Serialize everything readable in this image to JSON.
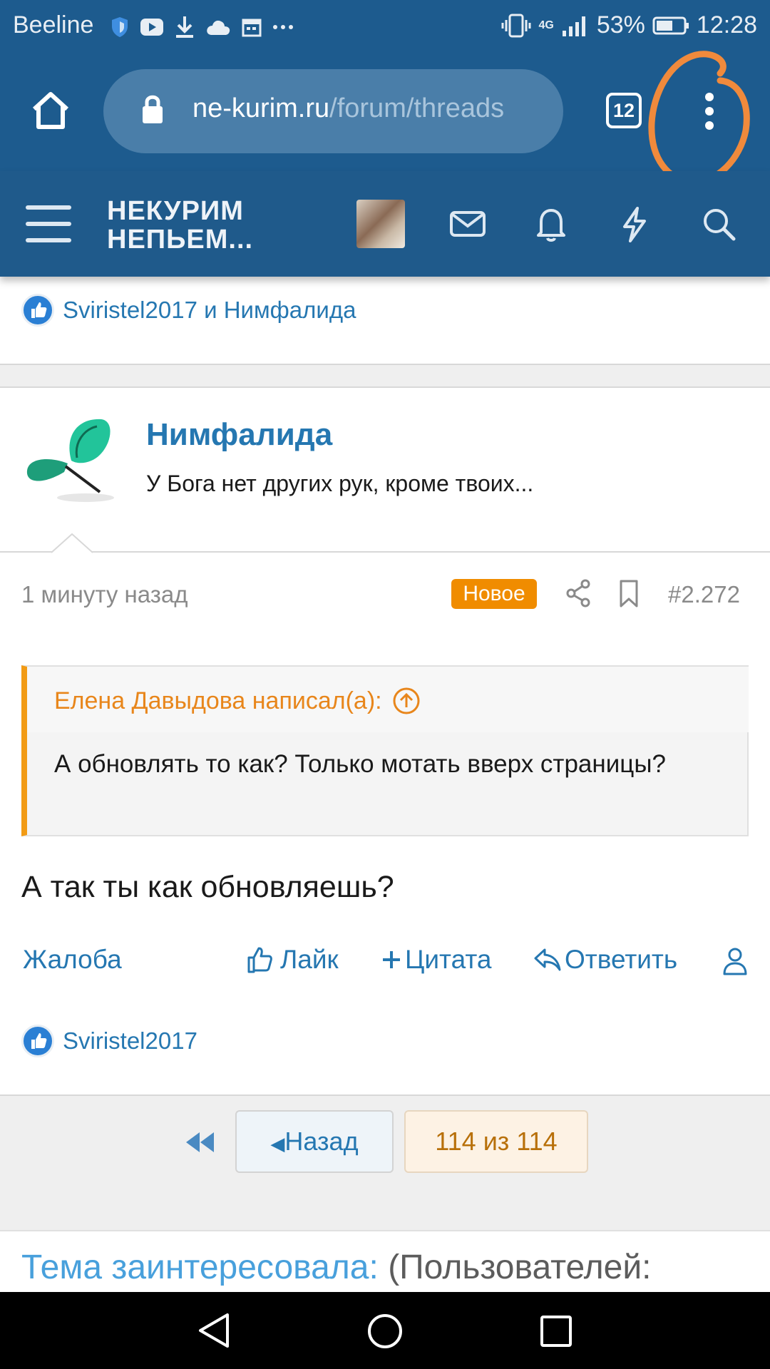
{
  "status_bar": {
    "carrier": "Beeline",
    "network": "4G",
    "battery": "53%",
    "time": "12:28",
    "icons": [
      "shield-icon",
      "youtube-icon",
      "download-icon",
      "cloud-icon",
      "calendar-icon",
      "more-dots-icon"
    ]
  },
  "browser": {
    "url_domain": "ne-kurim.ru",
    "url_path": "/forum/threads",
    "tab_count": "12",
    "annotation_color": "#f08a3c"
  },
  "site_header": {
    "logo_line1": "НЕКУРИМ",
    "logo_line2": "НЕПЬЕМ..."
  },
  "prev_post_likes": {
    "text": "Sviristel2017 и Нимфалида"
  },
  "post": {
    "username": "Нимфалида",
    "user_title": "У Бога нет других рук, кроме твоих...",
    "date": "1 минуту назад",
    "badge": "Новое",
    "number": "#2.272",
    "quote_author": "Елена Давыдова написал(а):",
    "quote_text": "А обновлять то как? Только мотать вверх страницы?",
    "text": "А так ты как обновляешь?",
    "actions": {
      "report": "Жалоба",
      "like": "Лайк",
      "quote": "Цитата",
      "reply": "Ответить"
    },
    "likes_text": "Sviristel2017"
  },
  "pagination": {
    "back_label": "Назад",
    "page_label": "114 из 114"
  },
  "footer": {
    "label": "Тема заинтересовала:",
    "count_text": "(Пользователей:"
  },
  "colors": {
    "header_bg": "#1d5b8e",
    "link_blue": "#2577b1",
    "accent_orange": "#f08c00"
  }
}
